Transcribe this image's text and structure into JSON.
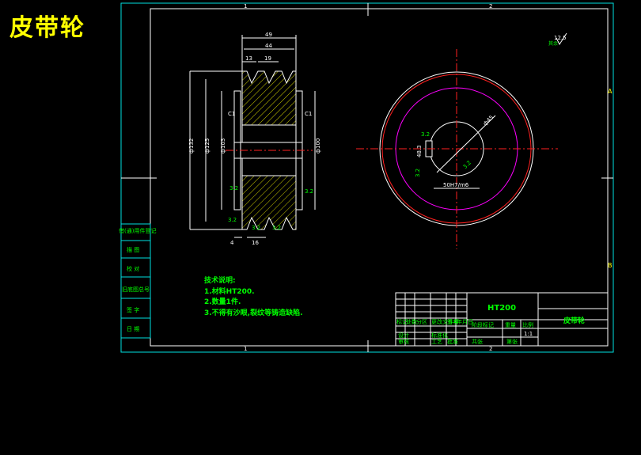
{
  "title": "皮带轮",
  "border": {
    "zone_top_left": "1",
    "zone_top_right": "2",
    "zone_bottom_left": "1",
    "zone_bottom_right": "2",
    "zone_right_a": "A",
    "zone_right_b": "B"
  },
  "roughness": {
    "value": "12.5",
    "prefix": "其余"
  },
  "side_labels": [
    "借(通)用件登记",
    "描 图",
    "校 对",
    "旧底图总号",
    "签 字",
    "日 期"
  ],
  "section_view": {
    "dims_top": [
      "49",
      "44",
      "13",
      "19"
    ],
    "chamfers": [
      "C1",
      "C1"
    ],
    "dims_vertical": [
      "ф132",
      "ф125",
      "ф103",
      "ф100"
    ],
    "roughness_marks": [
      "3.2",
      "3.2",
      "3.2",
      "3.2",
      "3.2"
    ],
    "dims_bottom": [
      "4",
      "16"
    ]
  },
  "front_view": {
    "dims": [
      "ф45",
      "3.2",
      "3.2",
      "48.3",
      "3.2",
      "50H7/m6"
    ]
  },
  "notes": {
    "heading": "技术说明:",
    "lines": [
      "1.材料HT200.",
      "2.数量1件.",
      "3.不得有沙眼,裂纹等铸造缺陷."
    ]
  },
  "title_block": {
    "material": "HT200",
    "part_name": "皮带轮",
    "cells": [
      "标记",
      "处数",
      "分区",
      "更改文件号",
      "签名",
      "年月日",
      "设计",
      "标准化",
      "阶段标记",
      "重量",
      "比例",
      "审核",
      "工艺",
      "批准",
      "共张",
      "第张"
    ],
    "scale": "1:1"
  }
}
